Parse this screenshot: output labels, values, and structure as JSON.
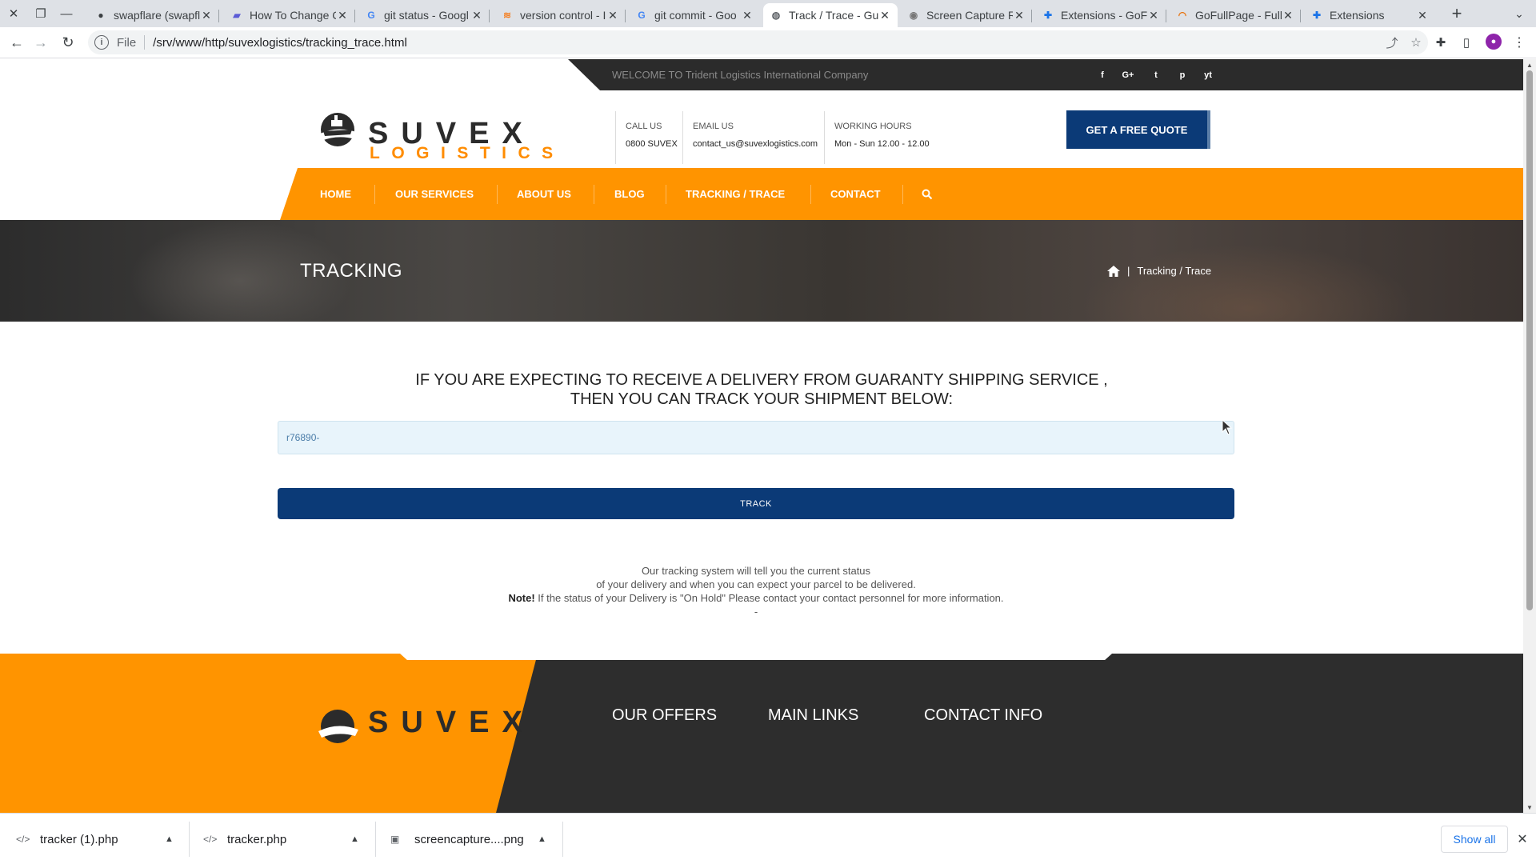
{
  "browser": {
    "tabs": [
      {
        "title": "swapflare (swapfl",
        "favicon": "github-icon",
        "active": false
      },
      {
        "title": "How To Change C",
        "favicon": "bookmark-icon",
        "active": false
      },
      {
        "title": "git status - Googl",
        "favicon": "google-icon",
        "active": false
      },
      {
        "title": "version control - I",
        "favicon": "stackoverflow-icon",
        "active": false
      },
      {
        "title": "git commit - Goo",
        "favicon": "google-icon",
        "active": false
      },
      {
        "title": "Track / Trace - Gu",
        "favicon": "globe-icon",
        "active": true
      },
      {
        "title": "Screen Capture R",
        "favicon": "camera-icon",
        "active": false
      },
      {
        "title": "Extensions - GoFu",
        "favicon": "puzzle-icon",
        "active": false
      },
      {
        "title": "GoFullPage - Full",
        "favicon": "gofullpage-icon",
        "active": false
      },
      {
        "title": "Extensions",
        "favicon": "puzzle-icon",
        "active": false
      }
    ],
    "address": {
      "scheme": "File",
      "url": "/srv/www/http/suvexlogistics/tracking_trace.html"
    }
  },
  "site": {
    "topbar": {
      "welcome": "WELCOME TO Trident Logistics International Company",
      "social": [
        "f",
        "G+",
        "t",
        "p",
        "yt"
      ]
    },
    "logo": {
      "word1": "SUVEX",
      "word2": "LOGISTICS"
    },
    "contact_info": [
      {
        "label": "CALL US",
        "value": "0800 SUVEX"
      },
      {
        "label": "EMAIL US",
        "value": "contact_us@suvexlogistics.com"
      },
      {
        "label": "WORKING HOURS",
        "value": "Mon - Sun 12.00 - 12.00"
      }
    ],
    "quote_button": "GET A FREE QUOTE",
    "nav": [
      "HOME",
      "OUR SERVICES",
      "ABOUT US",
      "BLOG",
      "TRACKING / TRACE",
      "CONTACT"
    ],
    "banner": {
      "title": "TRACKING",
      "breadcrumb_sep": "|",
      "breadcrumb_current": "Tracking / Trace"
    },
    "main": {
      "heading_line1": "IF YOU ARE EXPECTING TO RECEIVE A DELIVERY FROM GUARANTY SHIPPING SERVICE ,",
      "heading_line2": "THEN YOU CAN TRACK YOUR SHIPMENT BELOW:",
      "tracking_value": "r76890-",
      "track_button": "TRACK",
      "note_line1": "Our tracking system will tell you the current status",
      "note_line2": "of your delivery and when you can expect your parcel to be delivered.",
      "note_bold": "Note!",
      "note_line3": " If the status of your Delivery is \"On Hold\" Please contact your contact personnel for more information.",
      "note_dash": "-"
    },
    "footer": {
      "columns": [
        "OUR OFFERS",
        "MAIN LINKS",
        "CONTACT INFO"
      ]
    }
  },
  "downloads": {
    "items": [
      {
        "name": "tracker (1).php",
        "icon": "code-file-icon"
      },
      {
        "name": "tracker.php",
        "icon": "code-file-icon"
      },
      {
        "name": "screencapture....png",
        "icon": "image-file-icon"
      }
    ],
    "show_all": "Show all"
  },
  "colors": {
    "brand_orange": "#ff9400",
    "brand_navy": "#0b3a77",
    "dark_bar": "#2b2b2b"
  }
}
